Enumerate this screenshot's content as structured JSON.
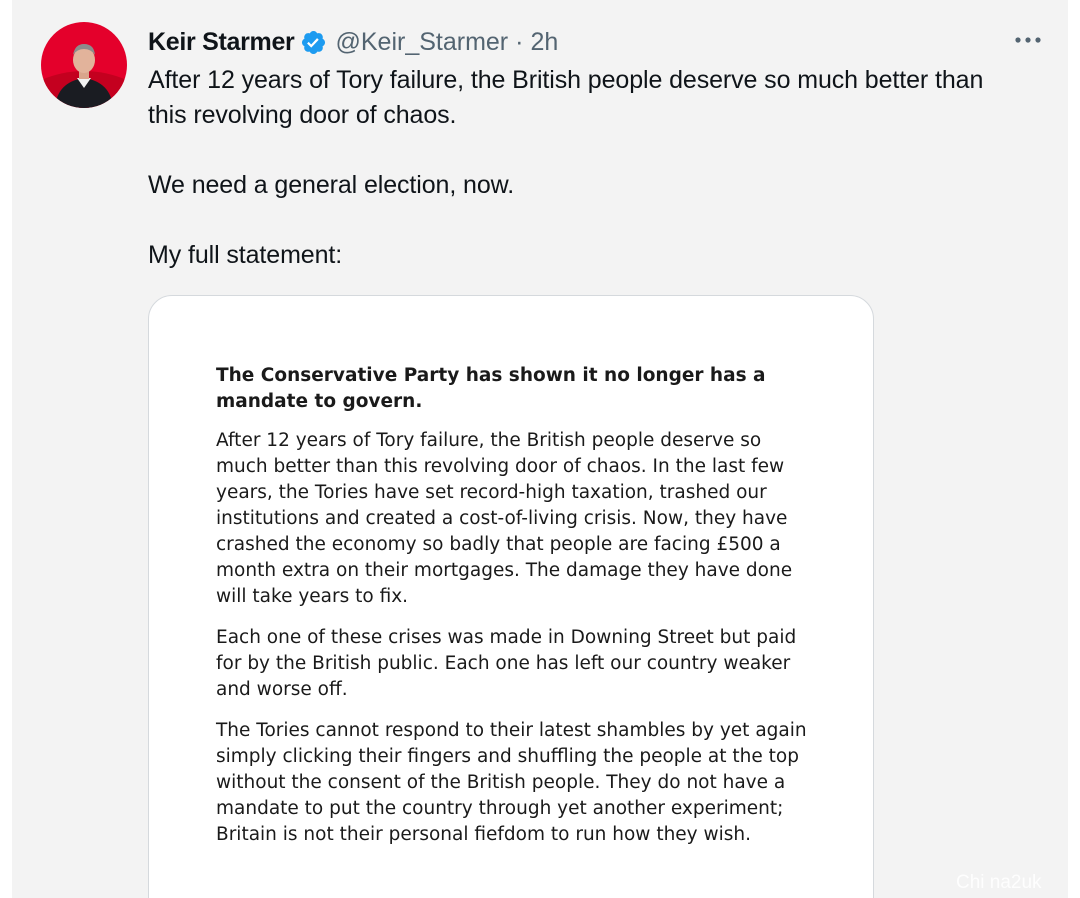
{
  "tweet": {
    "author_name": "Keir Starmer",
    "handle": "@Keir_Starmer",
    "separator": "·",
    "time": "2h",
    "verified_icon": "verified-badge-icon",
    "more_icon": "more-horizontal-icon",
    "text": {
      "p1": "After 12 years of Tory failure, the British people deserve so much better than this revolving door of chaos.",
      "p2": "We need a general election, now.",
      "p3": "My full statement:"
    }
  },
  "statement_image": {
    "heading": "The Conservative Party has shown it no longer has a mandate to govern.",
    "paragraphs": [
      "After 12 years of Tory failure, the British people deserve so much better than this revolving door of chaos. In the last few years, the Tories have set record-high taxation, trashed our institutions and created a cost-of-living crisis. Now, they have crashed the economy so badly that people are facing £500 a month extra on their mortgages. The damage they have done will take years to fix.",
      "Each one of these crises was made in Downing Street but paid for by the British public. Each one has left our country weaker and worse off.",
      "The Tories cannot respond to their latest shambles by yet again simply clicking their fingers and shuffling the people at the top without the consent of the British people. They do not have a mandate to put the country through yet another experiment; Britain is not their personal fiefdom to run how they wish."
    ]
  },
  "watermark": "Chi  na2uk",
  "colors": {
    "verified_blue": "#1d9bf0",
    "secondary_text": "#536471",
    "avatar_background": "#e4002b"
  }
}
